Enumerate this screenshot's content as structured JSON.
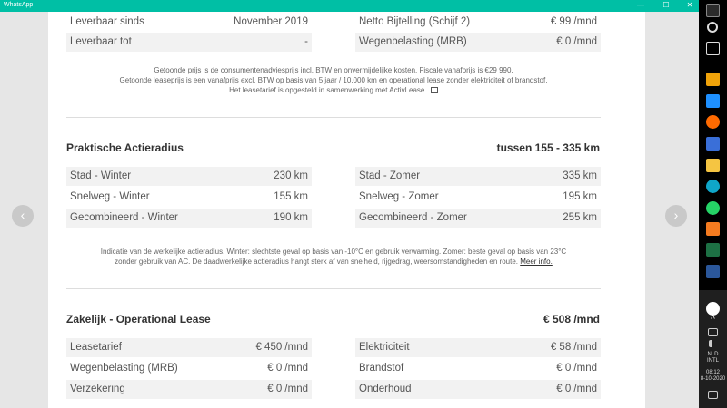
{
  "window": {
    "title": "WhatsApp",
    "minimize": "—",
    "maximize": "☐",
    "close": "✕"
  },
  "specs_top": {
    "left": [
      {
        "label": "Leverbaar sinds",
        "value": "November 2019"
      },
      {
        "label": "Leverbaar tot",
        "value": "-"
      }
    ],
    "right": [
      {
        "label": "Netto Bijtelling (Schijf 2)",
        "value": "€ 99 /mnd"
      },
      {
        "label": "Wegenbelasting (MRB)",
        "value": "€ 0 /mnd"
      }
    ]
  },
  "price_note": {
    "line1": "Getoonde prijs is de consumentenadviesprijs incl. BTW en onvermijdelijke kosten. Fiscale vanafprijs is €29 990.",
    "line2": "Getoonde leaseprijs is een vanafprijs excl. BTW op basis van 5 jaar / 10.000 km en operational lease zonder elektriciteit of brandstof.",
    "line3": "Het leasetarief is opgesteld in samenwerking met ActivLease."
  },
  "range": {
    "title": "Praktische Actieradius",
    "summary": "tussen 155 - 335 km",
    "left": [
      {
        "label": "Stad - Winter",
        "value": "230 km"
      },
      {
        "label": "Snelweg - Winter",
        "value": "155 km"
      },
      {
        "label": "Gecombineerd - Winter",
        "value": "190 km"
      }
    ],
    "right": [
      {
        "label": "Stad - Zomer",
        "value": "335 km"
      },
      {
        "label": "Snelweg - Zomer",
        "value": "195 km"
      },
      {
        "label": "Gecombineerd - Zomer",
        "value": "255 km"
      }
    ],
    "note_line1": "Indicatie van de werkelijke actieradius. Winter: slechtste geval op basis van -10°C en gebruik verwarming. Zomer: beste geval op basis van 23°C",
    "note_line2": "zonder gebruik van AC. De daadwerkelijke actieradius hangt sterk af van snelheid, rijgedrag, weersomstandigheden en route.",
    "more_info": "Meer info."
  },
  "lease": {
    "title": "Zakelijk - Operational Lease",
    "total": "€ 508 /mnd",
    "left": [
      {
        "label": "Leasetarief",
        "value": "€ 450 /mnd"
      },
      {
        "label": "Wegenbelasting (MRB)",
        "value": "€ 0 /mnd"
      },
      {
        "label": "Verzekering",
        "value": "€ 0 /mnd"
      }
    ],
    "right": [
      {
        "label": "Elektriciteit",
        "value": "€ 58 /mnd"
      },
      {
        "label": "Brandstof",
        "value": "€ 0 /mnd"
      },
      {
        "label": "Onderhoud",
        "value": "€ 0 /mnd"
      }
    ]
  },
  "nav": {
    "prev": "‹",
    "next": "›"
  },
  "taskbar": {
    "language": "NLD",
    "layout": "INTL",
    "time": "08:12",
    "date": "8-10-2020",
    "caret": "^"
  }
}
